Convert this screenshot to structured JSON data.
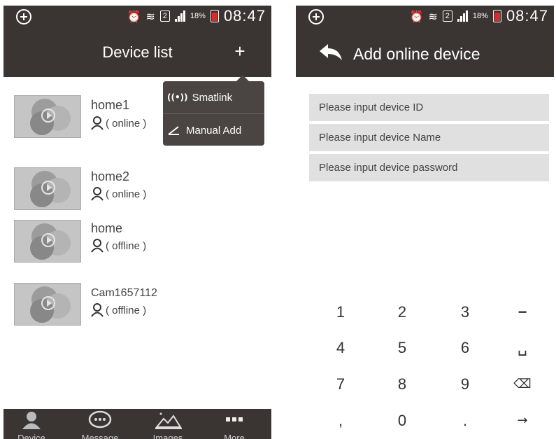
{
  "status": {
    "box_label": "2",
    "battery_pct": "18%",
    "time": "08:47"
  },
  "screen1": {
    "title": "Device list",
    "plus_label": "+",
    "devices": [
      {
        "name": "home1",
        "status": "( online )"
      },
      {
        "name": "home2",
        "status": "( online )"
      },
      {
        "name": "home",
        "status": "( offline )"
      },
      {
        "name": "Cam1657112",
        "status": "( offline )"
      }
    ],
    "popup": {
      "smartlink": "Smatlink",
      "manual_add": "Manual Add"
    },
    "tabs": [
      "Device",
      "Message",
      "Images",
      "More"
    ]
  },
  "screen2": {
    "title": "Add online device",
    "fields": [
      {
        "placeholder": "Please input device ID"
      },
      {
        "placeholder": "Please input device Name"
      },
      {
        "placeholder": "Please input device password"
      }
    ],
    "keys": [
      "1",
      "2",
      "3",
      "−",
      "4",
      "5",
      "6",
      "␣",
      "7",
      "8",
      "9",
      "⌫",
      ",",
      "0",
      ".",
      "→"
    ]
  }
}
